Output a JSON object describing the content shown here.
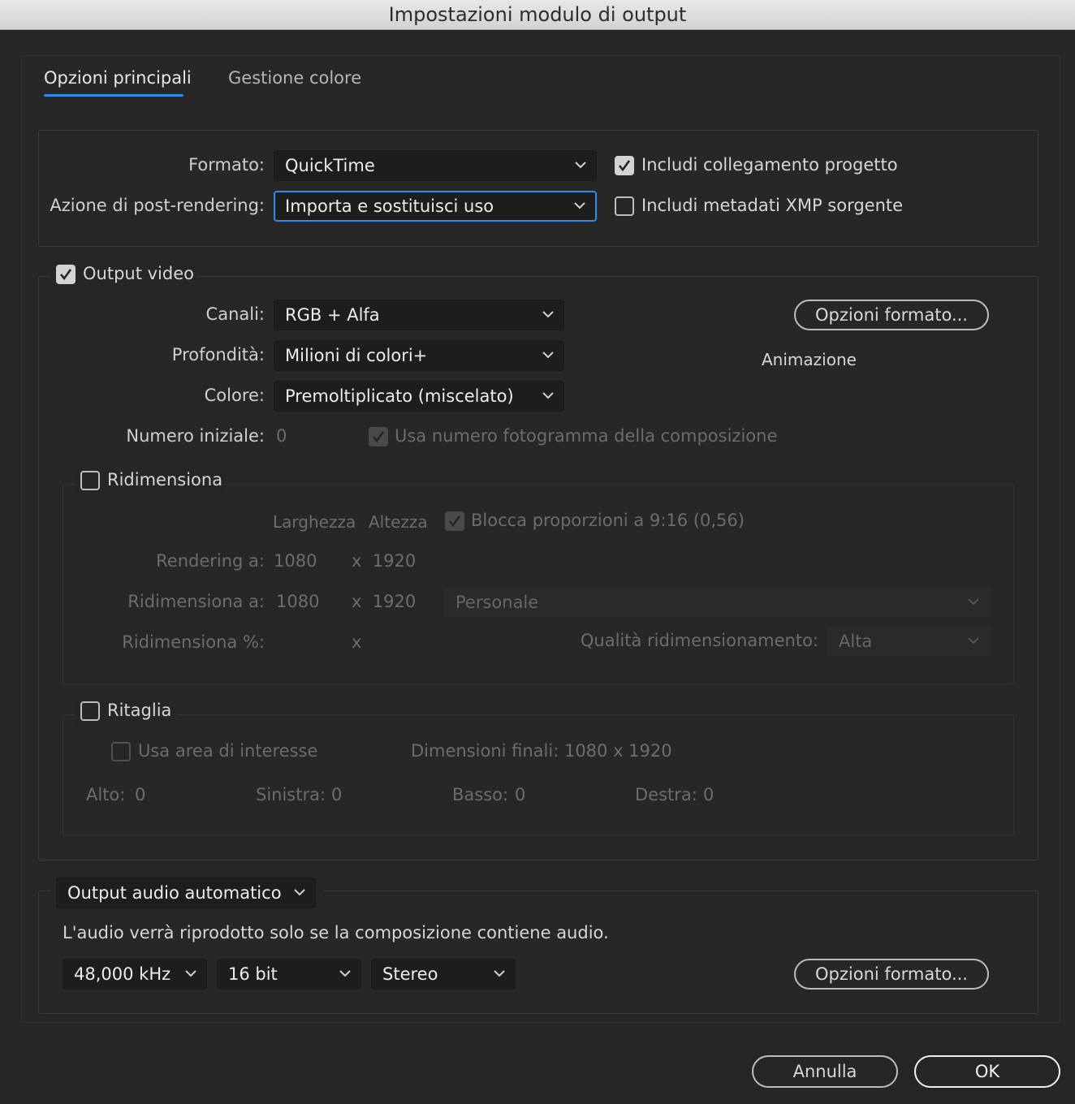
{
  "window": {
    "title": "Impostazioni modulo di output"
  },
  "tabs": [
    {
      "label": "Opzioni principali",
      "active": true
    },
    {
      "label": "Gestione colore",
      "active": false
    }
  ],
  "general": {
    "format_label": "Formato:",
    "format_value": "QuickTime",
    "post_render_label": "Azione di post-rendering:",
    "post_render_value": "Importa e sostituisci uso",
    "include_project_link": {
      "label": "Includi collegamento progetto",
      "checked": true
    },
    "include_xmp": {
      "label": "Includi metadati XMP sorgente",
      "checked": false
    }
  },
  "video": {
    "section_label": "Output video",
    "enabled": true,
    "channels_label": "Canali:",
    "channels_value": "RGB + Alfa",
    "depth_label": "Profondità:",
    "depth_value": "Milioni di colori+",
    "color_label": "Colore:",
    "color_value": "Premoltiplicato (miscelato)",
    "start_number_label": "Numero iniziale:",
    "start_number_value": "0",
    "use_comp_frame_label": "Usa numero fotogramma della composizione",
    "use_comp_frame_checked": true,
    "format_options_button": "Opzioni formato...",
    "codec_name": "Animazione"
  },
  "resize": {
    "label": "Ridimensiona",
    "enabled": false,
    "width_header": "Larghezza",
    "height_header": "Altezza",
    "lock_aspect_label": "Blocca proporzioni a 9:16 (0,56)",
    "lock_aspect_checked": true,
    "render_at_label": "Rendering a:",
    "render_at_width": "1080",
    "render_at_height": "x  1920",
    "resize_to_label": "Ridimensiona a:",
    "resize_to_width": "1080",
    "resize_to_height": "x  1920",
    "preset_value": "Personale",
    "resize_pct_label": "Ridimensiona %:",
    "resize_pct_x": "x",
    "quality_label": "Qualità ridimensionamento:",
    "quality_value": "Alta"
  },
  "crop": {
    "label": "Ritaglia",
    "enabled": false,
    "use_roi_label": "Usa area di interesse",
    "use_roi_checked": false,
    "final_size_text": "Dimensioni finali: 1080 x 1920",
    "top_label": "Alto:",
    "top_value": "0",
    "left_label": "Sinistra:",
    "left_value": "0",
    "bottom_label": "Basso:",
    "bottom_value": "0",
    "right_label": "Destra:",
    "right_value": "0"
  },
  "audio": {
    "mode_value": "Output audio automatico",
    "note": "L'audio verrà riprodotto solo se la composizione contiene audio.",
    "sample_rate": "48,000 kHz",
    "bit_depth": "16 bit",
    "channels": "Stereo",
    "format_options_button": "Opzioni formato..."
  },
  "footer": {
    "cancel_button": "Annulla",
    "ok_button": "OK"
  },
  "colors": {
    "accent": "#2d8ceb",
    "background": "#262626",
    "dropdown_bg": "#1d1d1d"
  }
}
